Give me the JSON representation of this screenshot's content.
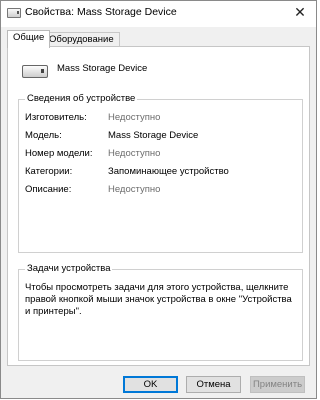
{
  "window": {
    "title": "Свойства: Mass Storage Device",
    "close_glyph": "✕"
  },
  "tabs": [
    {
      "label": "Общие",
      "active": true
    },
    {
      "label": "Оборудование",
      "active": false
    }
  ],
  "device": {
    "name": "Mass Storage Device",
    "icon": "storage-device-icon"
  },
  "properties": {
    "legend": "Сведения об устройстве",
    "rows": [
      {
        "label": "Изготовитель:",
        "value": "Недоступно",
        "muted": true
      },
      {
        "label": "Модель:",
        "value": "Mass Storage Device",
        "muted": false
      },
      {
        "label": "Номер модели:",
        "value": "Недоступно",
        "muted": true
      },
      {
        "label": "Категории:",
        "value": "Запоминающее устройство",
        "muted": false
      },
      {
        "label": "Описание:",
        "value": "Недоступно",
        "muted": true
      }
    ]
  },
  "tasks": {
    "legend": "Задачи устройства",
    "text": "Чтобы просмотреть задачи для этого устройства, щелкните правой кнопкой мыши значок устройства в окне \"Устройства и принтеры\"."
  },
  "buttons": {
    "ok": "OK",
    "cancel": "Отмена",
    "apply": "Применить"
  },
  "colors": {
    "default_button_border": "#0078d7",
    "muted_text": "#6d6d6d"
  }
}
